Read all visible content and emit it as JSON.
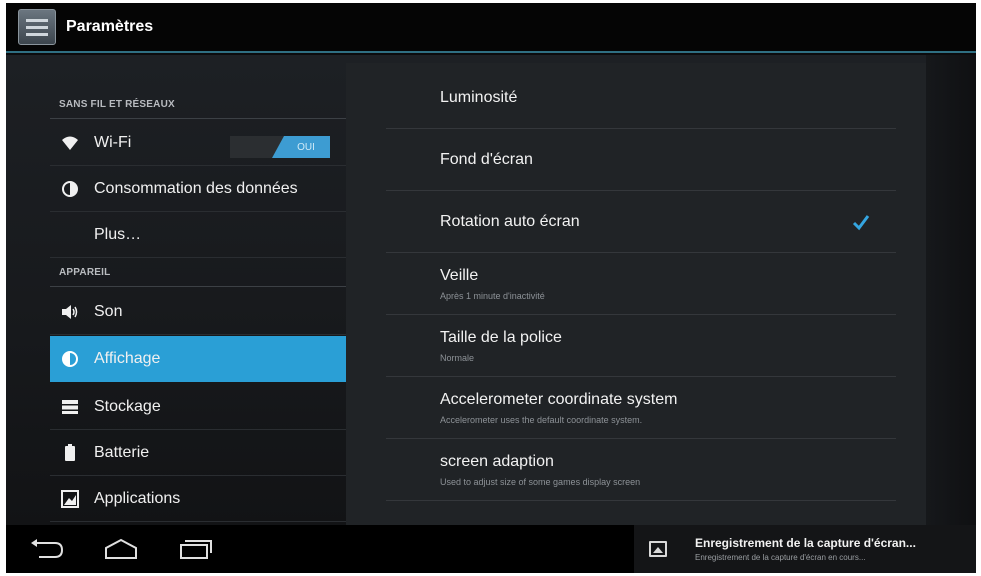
{
  "app": {
    "title": "Paramètres",
    "accent_color": "#2a9fd6"
  },
  "sidebar": {
    "categories": [
      {
        "header": "SANS FIL ET RÉSEAUX"
      },
      {
        "header": "APPAREIL"
      }
    ],
    "items": [
      {
        "label": "Wi-Fi",
        "icon": "wifi-icon",
        "toggle": "OUI",
        "toggle_state": "on"
      },
      {
        "label": "Consommation des données",
        "icon": "data-usage-icon"
      },
      {
        "label": "Plus…",
        "icon": ""
      },
      {
        "label": "Son",
        "icon": "speaker-icon"
      },
      {
        "label": "Affichage",
        "icon": "display-icon",
        "selected": true
      },
      {
        "label": "Stockage",
        "icon": "storage-icon"
      },
      {
        "label": "Batterie",
        "icon": "battery-icon"
      },
      {
        "label": "Applications",
        "icon": "apps-icon"
      }
    ]
  },
  "display_settings": [
    {
      "title": "Luminosité",
      "summary": ""
    },
    {
      "title": "Fond d'écran",
      "summary": ""
    },
    {
      "title": "Rotation auto écran",
      "summary": "",
      "checked": true
    },
    {
      "title": "Veille",
      "summary": "Après 1 minute d'inactivité"
    },
    {
      "title": "Taille de la police",
      "summary": "Normale"
    },
    {
      "title": "Accelerometer coordinate system",
      "summary": "Accelerometer uses the default coordinate system."
    },
    {
      "title": "screen adaption",
      "summary": "Used to adjust size of some games display screen"
    }
  ],
  "system_bar": {
    "buttons": [
      "back-icon",
      "home-icon",
      "recent-apps-icon"
    ],
    "notification": {
      "icon": "image-icon",
      "title": "Enregistrement de la capture d'écran...",
      "text": "Enregistrement de la capture d'écran en cours..."
    }
  }
}
